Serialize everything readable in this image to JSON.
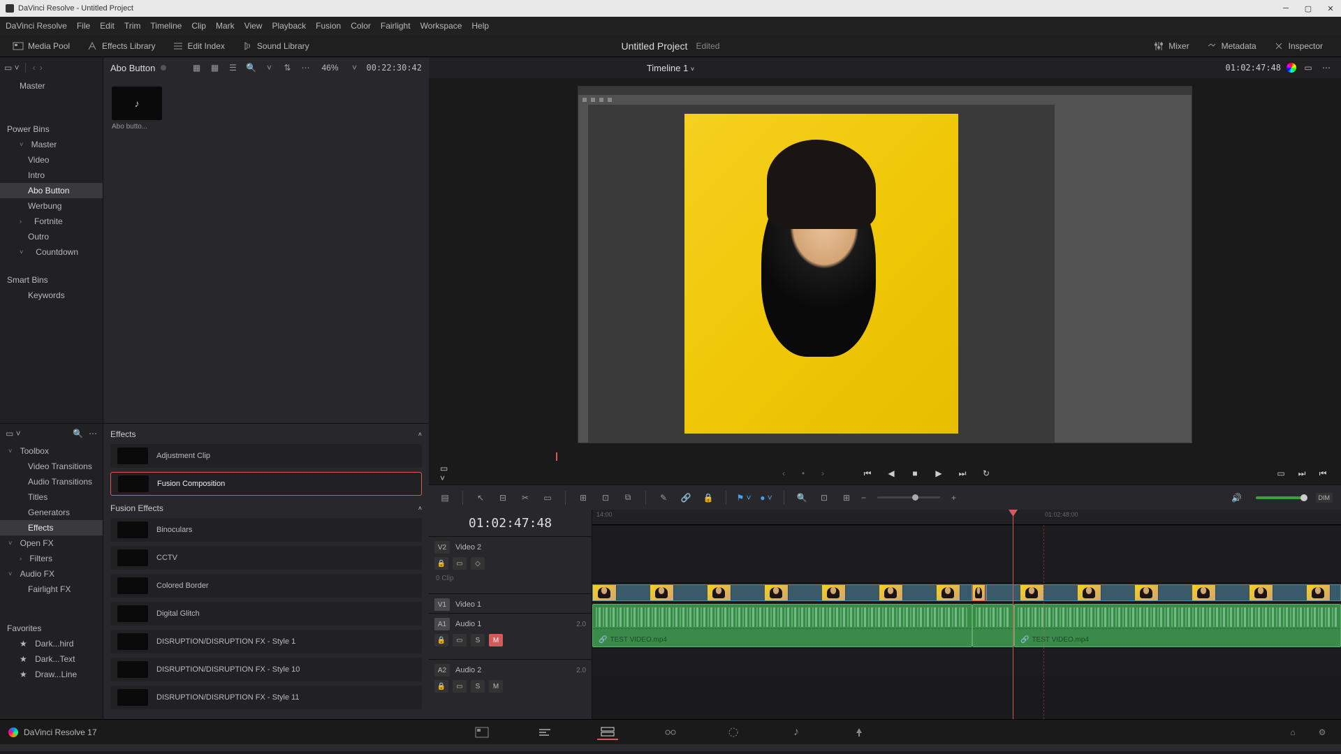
{
  "titlebar": {
    "app": "DaVinci Resolve",
    "project": "Untitled Project"
  },
  "menu": [
    "DaVinci Resolve",
    "File",
    "Edit",
    "Trim",
    "Timeline",
    "Clip",
    "Mark",
    "View",
    "Playback",
    "Fusion",
    "Color",
    "Fairlight",
    "Workspace",
    "Help"
  ],
  "toolbar": {
    "left": [
      {
        "label": "Media Pool",
        "icon": "media-pool-icon"
      },
      {
        "label": "Effects Library",
        "icon": "fx-icon"
      },
      {
        "label": "Edit Index",
        "icon": "index-icon"
      },
      {
        "label": "Sound Library",
        "icon": "sound-icon"
      }
    ],
    "project": "Untitled Project",
    "status": "Edited",
    "right": [
      {
        "label": "Mixer",
        "icon": "mixer-icon"
      },
      {
        "label": "Metadata",
        "icon": "meta-icon"
      },
      {
        "label": "Inspector",
        "icon": "inspector-icon"
      }
    ]
  },
  "bins": {
    "root": "Master",
    "power_label": "Power Bins",
    "power_items": [
      {
        "label": "Master",
        "expanded": true
      },
      {
        "label": "Video"
      },
      {
        "label": "Intro"
      },
      {
        "label": "Abo Button",
        "selected": true
      },
      {
        "label": "Werbung"
      },
      {
        "label": "Fortnite",
        "hasChildren": true
      },
      {
        "label": "Outro"
      },
      {
        "label": "Countdown",
        "expanded": true
      }
    ],
    "smart_label": "Smart Bins",
    "smart_items": [
      "Keywords"
    ]
  },
  "clips": {
    "title": "Abo Button",
    "zoom": "46%",
    "timecode": "00:22:30:42",
    "thumb_label": "Abo butto..."
  },
  "fx_tree": {
    "toolbox": "Toolbox",
    "toolbox_items": [
      "Video Transitions",
      "Audio Transitions",
      "Titles",
      "Generators",
      "Effects"
    ],
    "openfx": "Open FX",
    "openfx_items": [
      "Filters"
    ],
    "audiofx": "Audio FX",
    "audiofx_items": [
      "Fairlight FX"
    ],
    "favorites": "Favorites",
    "fav_items": [
      "Dark...hird",
      "Dark...Text",
      "Draw...Line"
    ]
  },
  "fx_list": {
    "section1": "Effects",
    "section1_items": [
      {
        "name": "Adjustment Clip"
      },
      {
        "name": "Fusion Composition",
        "selected": true
      }
    ],
    "section2": "Fusion Effects",
    "section2_items": [
      {
        "name": "Binoculars"
      },
      {
        "name": "CCTV"
      },
      {
        "name": "Colored Border"
      },
      {
        "name": "Digital Glitch"
      },
      {
        "name": "DISRUPTION/DISRUPTION FX - Style 1"
      },
      {
        "name": "DISRUPTION/DISRUPTION FX - Style 10"
      },
      {
        "name": "DISRUPTION/DISRUPTION FX - Style 11"
      }
    ]
  },
  "viewer": {
    "timeline_name": "Timeline 1",
    "timecode": "01:02:47:48"
  },
  "timeline": {
    "timecode": "01:02:47:48",
    "ruler_ticks": [
      "14:00",
      "01:02:48:00"
    ],
    "tracks": {
      "v2": {
        "id": "V2",
        "name": "Video 2",
        "clipinfo": "0 Clip"
      },
      "v1": {
        "id": "V1",
        "name": "Video 1"
      },
      "a1": {
        "id": "A1",
        "name": "Audio 1",
        "ch": "2.0",
        "solo": "S",
        "mute": "M"
      },
      "a2": {
        "id": "A2",
        "name": "Audio 2",
        "ch": "2.0",
        "solo": "S",
        "mute": "M"
      }
    },
    "clips": {
      "a1_name": "TEST VIDEO.mp4",
      "a1b_name": "TEST VIDEO.mp4"
    }
  },
  "footer": {
    "app_version": "DaVinci Resolve 17"
  }
}
